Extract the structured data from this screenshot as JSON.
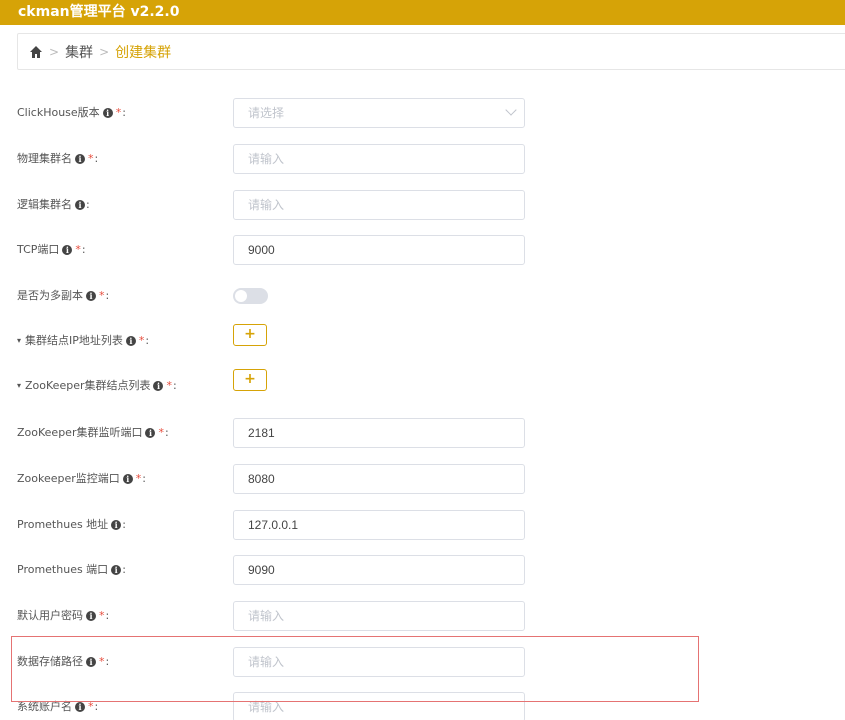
{
  "header": {
    "title": "ckman管理平台 v2.2.0"
  },
  "breadcrumb": {
    "home_icon": "home-icon",
    "items": [
      "集群",
      "创建集群"
    ],
    "separator": ">"
  },
  "colors": {
    "brand": "#d6a307",
    "required": "#e74c3c",
    "highlight": "#e57373"
  },
  "form": {
    "fields": [
      {
        "label": "ClickHouse版本",
        "required": true,
        "type": "select",
        "placeholder": "请选择",
        "value": ""
      },
      {
        "label": "物理集群名",
        "required": true,
        "type": "input",
        "placeholder": "请输入",
        "value": ""
      },
      {
        "label": "逻辑集群名",
        "required": false,
        "type": "input",
        "placeholder": "请输入",
        "value": ""
      },
      {
        "label": "TCP端口",
        "required": true,
        "type": "input",
        "placeholder": "",
        "value": "9000"
      },
      {
        "label": "是否为多副本",
        "required": true,
        "type": "toggle",
        "value": false
      },
      {
        "label": "集群结点IP地址列表",
        "required": true,
        "type": "add",
        "button": "+"
      },
      {
        "label": "ZooKeeper集群结点列表",
        "required": true,
        "type": "add",
        "button": "+"
      },
      {
        "label": "ZooKeeper集群监听端口",
        "required": true,
        "type": "input",
        "placeholder": "",
        "value": "2181"
      },
      {
        "label": "Zookeeper监控端口",
        "required": true,
        "type": "input",
        "placeholder": "",
        "value": "8080"
      },
      {
        "label": "Promethues 地址",
        "required": false,
        "type": "input",
        "placeholder": "",
        "value": "127.0.0.1"
      },
      {
        "label": "Promethues 端口",
        "required": false,
        "type": "input",
        "placeholder": "",
        "value": "9090"
      },
      {
        "label": "默认用户密码",
        "required": true,
        "type": "input",
        "placeholder": "请输入",
        "value": ""
      },
      {
        "label": "数据存储路径",
        "required": true,
        "type": "input",
        "placeholder": "请输入",
        "value": ""
      },
      {
        "label": "系统账户名",
        "required": true,
        "type": "input",
        "placeholder": "请输入",
        "value": ""
      }
    ],
    "required_mark": "*",
    "colon": ":",
    "info_icon": "i",
    "caret": "▾"
  }
}
